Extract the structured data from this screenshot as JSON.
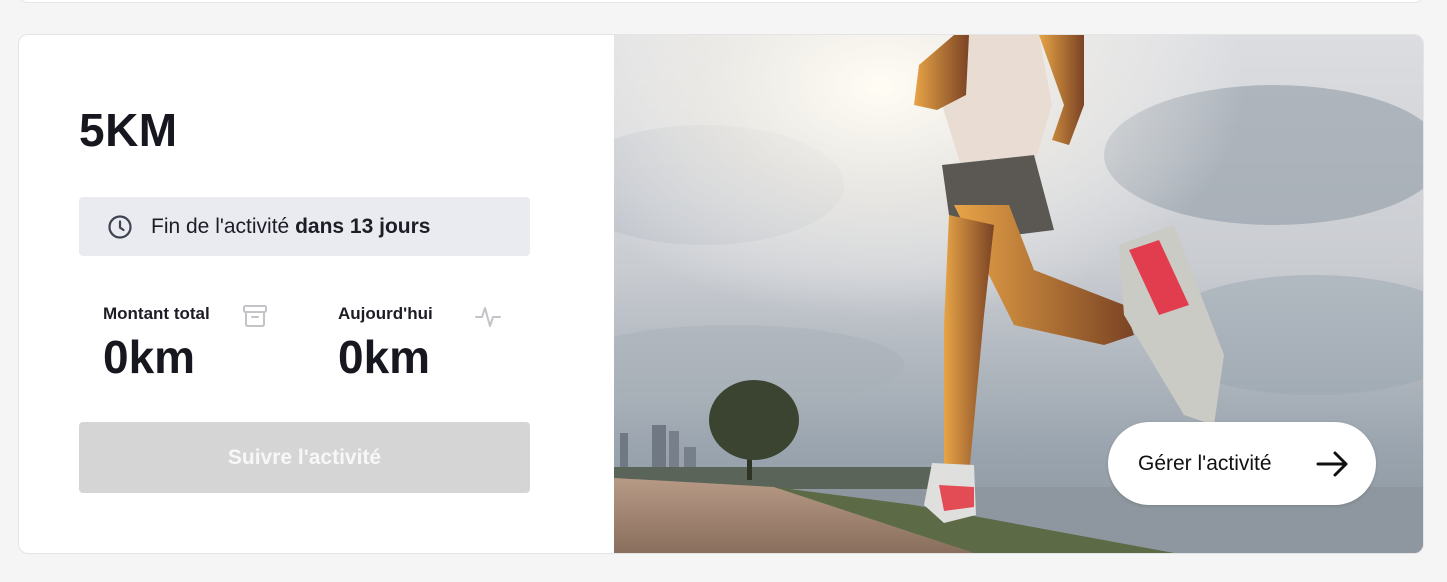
{
  "activity": {
    "title": "5KM",
    "deadline_prefix": "Fin de l'activité",
    "deadline_bold": "dans 13 jours",
    "stats": {
      "total": {
        "label": "Montant total",
        "value": "0km",
        "icon": "archive-box-icon"
      },
      "today": {
        "label": "Aujourd'hui",
        "value": "0km",
        "icon": "pulse-icon"
      }
    },
    "follow_button": "Suivre l'activité",
    "manage_button": "Gérer l'activité"
  },
  "colors": {
    "title_text": "#17171f",
    "deadline_background": "#e9ebf1",
    "disabled_button": "#d5d5d5",
    "page_background": "#f5f5f5"
  }
}
